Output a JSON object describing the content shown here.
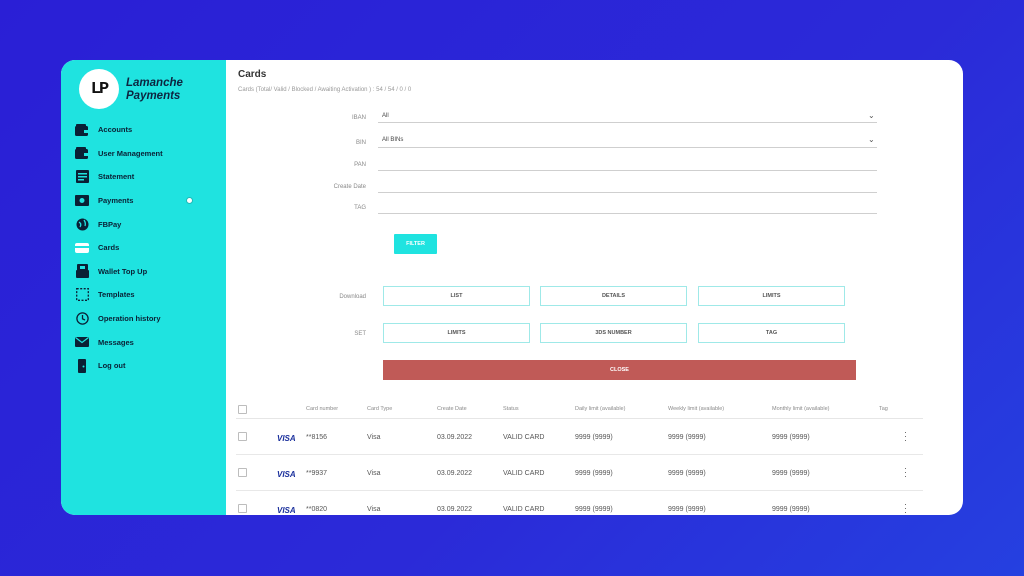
{
  "brand": {
    "logo_text": "LP",
    "name": "Lamanche Payments"
  },
  "sidebar": {
    "items": [
      {
        "label": "Accounts",
        "icon": "wallet-icon"
      },
      {
        "label": "User Management",
        "icon": "wallet-icon"
      },
      {
        "label": "Statement",
        "icon": "statement-icon"
      },
      {
        "label": "Payments",
        "icon": "payments-icon"
      },
      {
        "label": "FBPay",
        "icon": "globe-icon"
      },
      {
        "label": "Cards",
        "icon": "cards-icon"
      },
      {
        "label": "Wallet Top Up",
        "icon": "wallet-topup-icon"
      },
      {
        "label": "Templates",
        "icon": "templates-icon"
      },
      {
        "label": "Operation history",
        "icon": "history-icon"
      },
      {
        "label": "Messages",
        "icon": "envelope-icon"
      },
      {
        "label": "Log out",
        "icon": "logout-icon"
      }
    ]
  },
  "page": {
    "title": "Cards",
    "subtitle": "Cards (Total/ Valid / Blocked / Awaiting Activation ) : 54 / 54 / 0 / 0"
  },
  "filters": {
    "iban_label": "IBAN",
    "iban_value": "All",
    "bin_label": "BIN",
    "bin_value": "All BINs",
    "pan_label": "PAN",
    "create_date_label": "Create Date",
    "tag_label": "TAG",
    "filter_button": "FILTER"
  },
  "actions": {
    "download_label": "Download",
    "download_list": "LIST",
    "download_details": "DETAILS",
    "download_limits": "LIMITS",
    "set_label": "SET",
    "set_limits": "LIMITS",
    "set_3ds": "3DS NUMBER",
    "set_tag": "TAG",
    "close_button": "CLOSE"
  },
  "table": {
    "columns": [
      "Card number",
      "Card Type",
      "Create Date",
      "Status",
      "Daily limit (available)",
      "Weekly limit (available)",
      "Monthly limit (available)",
      "Tag"
    ],
    "rows": [
      {
        "brand": "VISA",
        "card_number": "**8156",
        "card_type": "Visa",
        "create_date": "03.09.2022",
        "status": "VALID CARD",
        "daily": "9999 (9999)",
        "weekly": "9999 (9999)",
        "monthly": "9999 (9999)"
      },
      {
        "brand": "VISA",
        "card_number": "**9937",
        "card_type": "Visa",
        "create_date": "03.09.2022",
        "status": "VALID CARD",
        "daily": "9999 (9999)",
        "weekly": "9999 (9999)",
        "monthly": "9999 (9999)"
      },
      {
        "brand": "VISA",
        "card_number": "**0820",
        "card_type": "Visa",
        "create_date": "03.09.2022",
        "status": "VALID CARD",
        "daily": "9999 (9999)",
        "weekly": "9999 (9999)",
        "monthly": "9999 (9999)"
      }
    ]
  },
  "colors": {
    "sidebar": "#1fe3e0",
    "close": "#c05a57",
    "background": "#2a1fd6"
  }
}
